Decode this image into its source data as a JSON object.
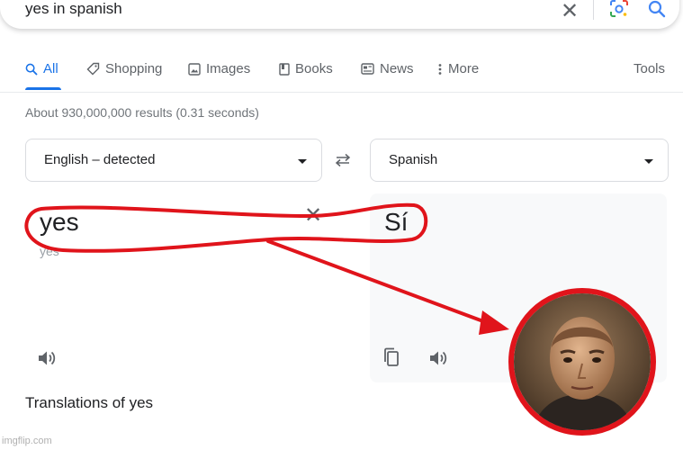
{
  "search": {
    "query": "yes in spanish",
    "clear_glyph": "✕"
  },
  "tabs": [
    {
      "label": "All",
      "icon": "search-icon"
    },
    {
      "label": "Shopping",
      "icon": "tag-icon"
    },
    {
      "label": "Images",
      "icon": "image-icon"
    },
    {
      "label": "Books",
      "icon": "book-icon"
    },
    {
      "label": "News",
      "icon": "news-icon"
    },
    {
      "label": "More",
      "icon": "more-vert-icon"
    }
  ],
  "tools_label": "Tools",
  "results_stats": "About 930,000,000 results (0.31 seconds)",
  "translator": {
    "source_lang": "English – detected",
    "target_lang": "Spanish",
    "source_text": "yes",
    "source_transliteration": "yes",
    "target_text": "Sí",
    "translations_heading": "Translations of yes"
  },
  "annotation": {
    "color": "#e0141b",
    "portrait_icon": "person-portrait-icon"
  },
  "watermark": "imgflip.com",
  "colors": {
    "accent": "#1a73e8",
    "text_secondary": "#5f6368",
    "annotation_red": "#e0141b"
  }
}
